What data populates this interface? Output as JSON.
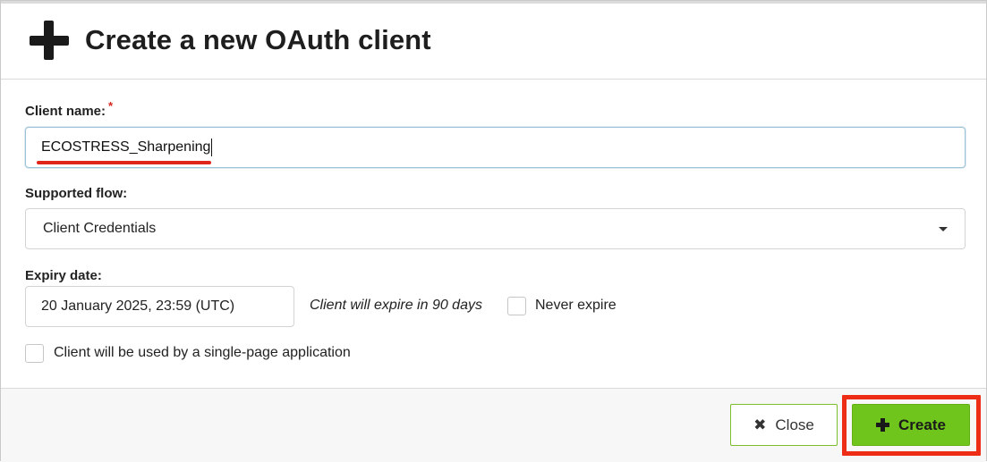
{
  "header": {
    "title": "Create a new OAuth client",
    "icon": "plus-icon"
  },
  "form": {
    "client_name": {
      "label": "Client name:",
      "required_marker": "*",
      "value": "ECOSTRESS_Sharpening"
    },
    "supported_flow": {
      "label": "Supported flow:",
      "selected": "Client Credentials"
    },
    "expiry_date": {
      "label": "Expiry date:",
      "value": "20 January 2025, 23:59 (UTC)",
      "note": "Client will expire in 90 days",
      "never_expire_label": "Never expire",
      "never_expire_checked": false
    },
    "single_page_app": {
      "label": "Client will be used by a single-page application",
      "checked": false
    }
  },
  "footer": {
    "close_label": "Close",
    "close_icon": "close-icon",
    "create_label": "Create",
    "create_icon": "plus-icon"
  },
  "colors": {
    "accent_green": "#6fc51c",
    "highlight_red": "#ee2d16",
    "required_red": "#d9251c"
  }
}
